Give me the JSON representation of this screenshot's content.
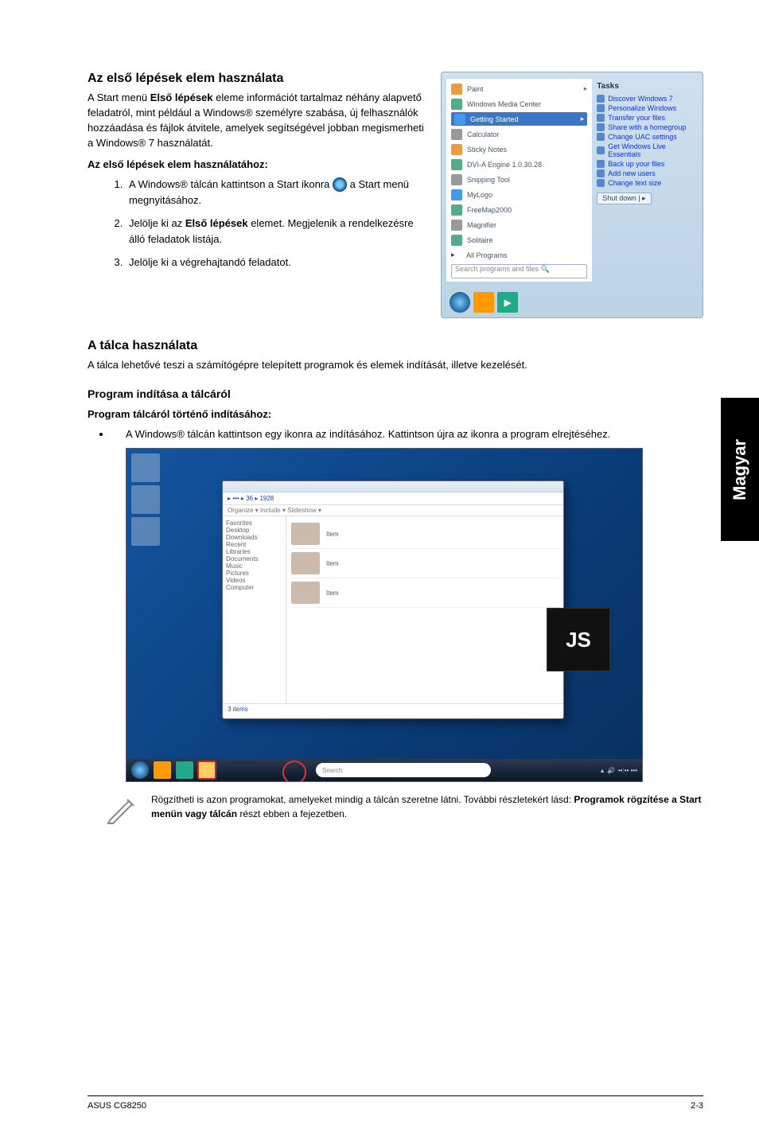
{
  "section1": {
    "heading": "Az első lépések elem használata",
    "paragraph": "A Start menü Első lépések eleme információt tartalmaz néhány alapvető feladatról, mint például a Windows® személyre szabása, új felhasználók hozzáadása és fájlok átvitele, amelyek segítségével jobban megismerheti a Windows® 7 használatát.",
    "paragraph_bold": "Első lépések",
    "howto_heading": "Az első lépések elem használatához:",
    "steps": [
      {
        "n": "1",
        "text_before": "A Windows® tálcán kattintson a Start ikonra ",
        "text_after": " a Start menü megnyitásához."
      },
      {
        "n": "2",
        "text": "Jelölje ki az Első lépések elemet. Megjelenik a rendelkezésre álló feladatok listája.",
        "bold": "Első lépések"
      },
      {
        "n": "3",
        "text": "Jelölje ki a végrehajtandó feladatot."
      }
    ]
  },
  "startmenu": {
    "left_items": [
      "Paint",
      "Windows Media Center",
      "Getting Started",
      "Calculator",
      "Sticky Notes",
      "DVI-A Engine 1.0.30.28",
      "Snipping Tool",
      "MyLogo",
      "FreeMap2000",
      "Magnifier",
      "Solitaire"
    ],
    "selected_index": 2,
    "all_programs": "All Programs",
    "search_placeholder": "Search programs and files",
    "tasks_title": "Tasks",
    "tasks": [
      "Discover Windows 7",
      "Personalize Windows",
      "Transfer your files",
      "Share with a homegroup",
      "Change UAC settings",
      "Get Windows Live Essentials",
      "Back up your files",
      "Add new users",
      "Change text size"
    ],
    "shutdown": "Shut down | ▸"
  },
  "section2": {
    "heading": "A tálca használata",
    "paragraph": "A tálca lehetővé teszi a számítógépre telepített programok és elemek indítását, illetve kezelését.",
    "sub_heading": "Program indítása a tálcáról",
    "howto_heading": "Program tálcáról történő indításához:",
    "bullet": "A Windows® tálcán kattintson egy ikonra az indításához. Kattintson újra az ikonra a program elrejtéséhez."
  },
  "explorer": {
    "path": "▸ ••• ▸ 36 ▸ 1928",
    "toolbar": "Organize ▾   Include ▾   Slideshow ▾",
    "nav": [
      "Favorites",
      "Desktop",
      "Downloads",
      "Recent",
      "Libraries",
      "Documents",
      "Music",
      "Pictures",
      "Videos",
      "Computer"
    ],
    "rows": [
      "Item",
      "Item",
      "Item"
    ],
    "status": "3 items",
    "search": "Search",
    "logo": "JS",
    "tray_time": "••:•• •••"
  },
  "note": {
    "text_before": "Rögzítheti is azon programokat, amelyeket mindig a tálcán szeretne látni. További részletekért lásd: ",
    "bold": "Programok rögzítése a Start menün vagy tálcán",
    "text_after": " részt ebben a fejezetben."
  },
  "side_tab": "Magyar",
  "footer": {
    "left": "ASUS CG8250",
    "right": "2-3"
  }
}
